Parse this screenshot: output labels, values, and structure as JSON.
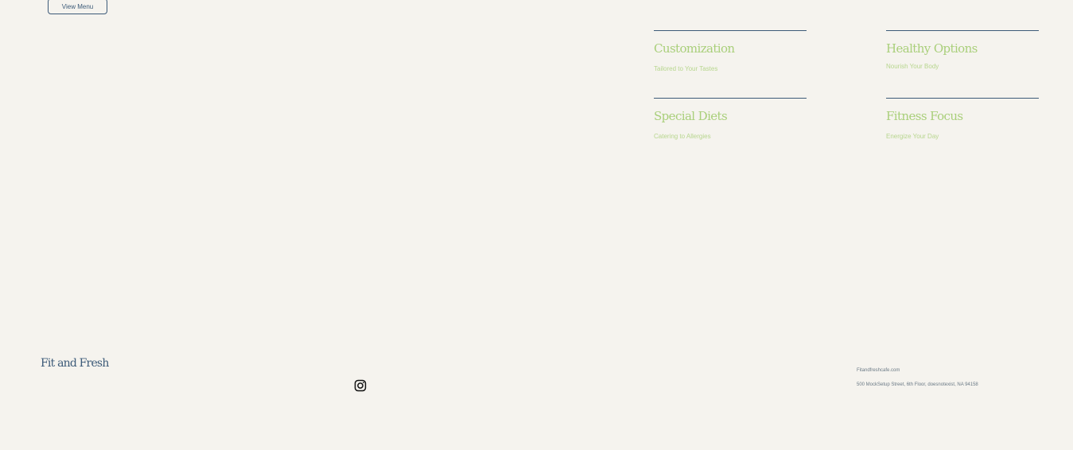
{
  "header": {
    "view_menu_label": "View Menu"
  },
  "features": [
    {
      "title": "Customization",
      "subtitle": "Tailored to Your Tastes"
    },
    {
      "title": "Healthy Options",
      "subtitle": "Nourish Your Body"
    },
    {
      "title": "Special Diets",
      "subtitle": "Catering to Allergies"
    },
    {
      "title": "Fitness Focus",
      "subtitle": "Energize Your Day"
    }
  ],
  "footer": {
    "brand": "Fit and Fresh",
    "social_icon": "instagram-icon",
    "email": "Fitandfreshcafe.com",
    "address": "500 MockSetup Street, 6th Floor, doesnotexist, NA 94158"
  },
  "colors": {
    "background": "#f5f3ee",
    "primary": "#3c5a78",
    "accent_green": "#a9cf7a"
  }
}
